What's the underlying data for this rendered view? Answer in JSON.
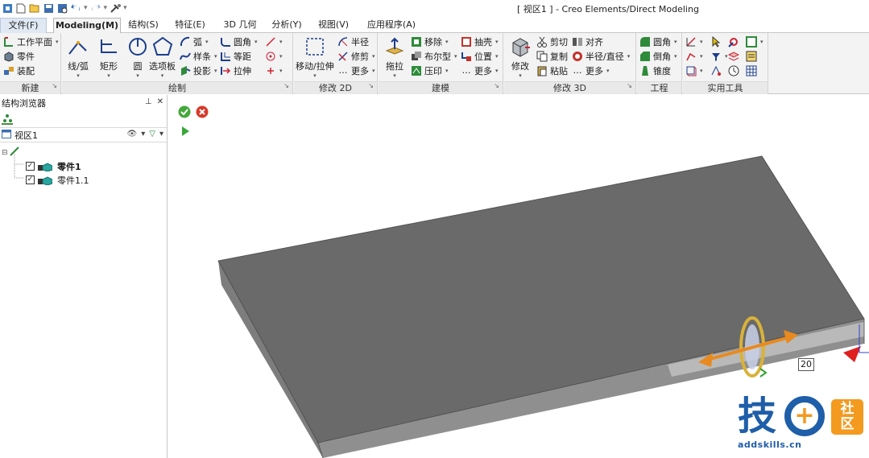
{
  "window": {
    "title": "[ 视区1 ] - Creo Elements/Direct Modeling"
  },
  "tabs": [
    "文件(F)",
    "Modeling(M)",
    "结构(S)",
    "特征(E)",
    "3D 几何",
    "分析(Y)",
    "视图(V)",
    "应用程序(A)"
  ],
  "ribbon": {
    "groups": {
      "new": "新建",
      "draw": "绘制",
      "modify2d": "修改 2D",
      "build": "建模",
      "modify3d": "修改 3D",
      "engineering": "工程",
      "utilities": "实用工具"
    },
    "new": {
      "workplane": "工作平面",
      "part": "零件",
      "assembly": "装配"
    },
    "draw": {
      "line_arc": "线/弧",
      "rect": "矩形",
      "circle": "圆",
      "palette": "选项板",
      "arc": "弧",
      "spline": "样条",
      "project": "投影",
      "fillet": "圆角",
      "offset": "等距",
      "extend": "拉伸"
    },
    "modify2d": {
      "move_stretch": "移动/拉伸",
      "radius": "半径",
      "trim": "修剪",
      "more": "更多"
    },
    "build": {
      "pull": "拖拉",
      "remove": "移除",
      "boolean": "布尔型",
      "imprint": "压印",
      "shell": "抽壳",
      "position": "位置",
      "more": "更多"
    },
    "modify3d": {
      "modify": "修改",
      "cut": "剪切",
      "copy": "复制",
      "paste": "粘贴",
      "align": "对齐",
      "radius_diameter": "半径/直径",
      "more": "更多"
    },
    "engineering": {
      "round": "圆角",
      "chamfer": "倒角",
      "taper": "锥度"
    }
  },
  "browser": {
    "title": "结构浏览器",
    "viewport_label": "视区1",
    "items": [
      {
        "label": "零件1",
        "checked": true,
        "bold": true
      },
      {
        "label": "零件1.1",
        "checked": true,
        "bold": false
      }
    ]
  },
  "viewport": {
    "dimension_value": "20"
  },
  "watermark": {
    "big_char": "技",
    "side_top": "社",
    "side_bottom": "区",
    "url": "addskills.cn"
  },
  "colors": {
    "tab_file_bg": "#dfe8f3",
    "ribbon_bg": "#f3f3f3",
    "plate_top": "#6a6a6a",
    "plate_side": "#8c8c8c",
    "brand_blue": "#1f5ea8",
    "brand_orange": "#f39a1f"
  }
}
